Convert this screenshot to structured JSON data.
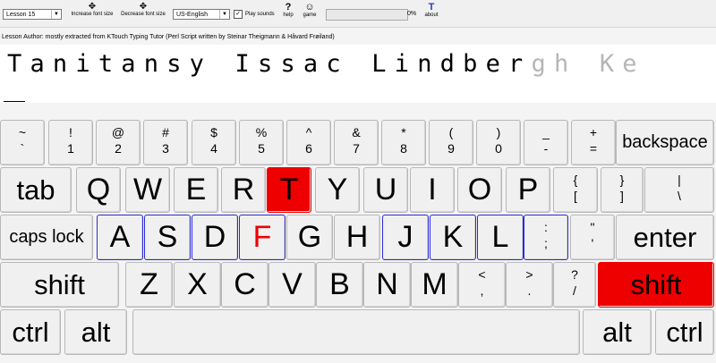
{
  "toolbar": {
    "lesson_select": "Lesson 15",
    "increase_font": "Increase font size",
    "decrease_font": "Decrease font size",
    "layout_select": "US-English",
    "play_sounds_label": "Play sounds",
    "play_sounds_checked": true,
    "help_label": "help",
    "game_label": "game",
    "progress_text": "0%",
    "progress_value": 0,
    "about_label": "about"
  },
  "author_text": "Lesson Author: mostly extracted from KTouch Typing Tutor (Perl Script written by Steinar Theigmann & Håvard Frøiland)",
  "practice": {
    "typed": "Tanitansy Issac Lindber",
    "pending": "gh Ke"
  },
  "keyboard": {
    "rows": [
      [
        {
          "id": "k-tilde",
          "top": "~",
          "bot": "`"
        },
        {
          "id": "k-1",
          "top": "!",
          "bot": "1"
        },
        {
          "id": "k-2",
          "top": "@",
          "bot": "2"
        },
        {
          "id": "k-3",
          "top": "#",
          "bot": "3"
        },
        {
          "id": "k-4",
          "top": "$",
          "bot": "4"
        },
        {
          "id": "k-5",
          "top": "%",
          "bot": "5"
        },
        {
          "id": "k-6",
          "top": "^",
          "bot": "6"
        },
        {
          "id": "k-7",
          "top": "&",
          "bot": "7"
        },
        {
          "id": "k-8",
          "top": "*",
          "bot": "8"
        },
        {
          "id": "k-9",
          "top": "(",
          "bot": "9"
        },
        {
          "id": "k-0",
          "top": ")",
          "bot": "0"
        },
        {
          "id": "k-minus",
          "top": "_",
          "bot": "-"
        },
        {
          "id": "k-equals",
          "top": "+",
          "bot": "="
        },
        {
          "id": "k-backspace",
          "label": "backspace"
        }
      ],
      [
        {
          "id": "k-tab",
          "label": "tab"
        },
        {
          "id": "k-q",
          "label": "Q"
        },
        {
          "id": "k-w",
          "label": "W"
        },
        {
          "id": "k-e",
          "label": "E"
        },
        {
          "id": "k-r",
          "label": "R"
        },
        {
          "id": "k-t",
          "label": "T"
        },
        {
          "id": "k-y",
          "label": "Y"
        },
        {
          "id": "k-u",
          "label": "U"
        },
        {
          "id": "k-i",
          "label": "I"
        },
        {
          "id": "k-o",
          "label": "O"
        },
        {
          "id": "k-p",
          "label": "P"
        },
        {
          "id": "k-lbracket",
          "top": "{",
          "bot": "["
        },
        {
          "id": "k-rbracket",
          "top": "}",
          "bot": "]"
        },
        {
          "id": "k-backslash",
          "top": "|",
          "bot": "\\"
        }
      ],
      [
        {
          "id": "k-capslock",
          "label": "caps lock"
        },
        {
          "id": "k-a",
          "label": "A"
        },
        {
          "id": "k-s",
          "label": "S"
        },
        {
          "id": "k-d",
          "label": "D"
        },
        {
          "id": "k-f",
          "label": "F"
        },
        {
          "id": "k-g",
          "label": "G"
        },
        {
          "id": "k-h",
          "label": "H"
        },
        {
          "id": "k-j",
          "label": "J"
        },
        {
          "id": "k-k",
          "label": "K"
        },
        {
          "id": "k-l",
          "label": "L"
        },
        {
          "id": "k-semicolon",
          "top": ":",
          "bot": ";"
        },
        {
          "id": "k-quote",
          "top": "\"",
          "bot": "'"
        },
        {
          "id": "k-enter",
          "label": "enter"
        }
      ],
      [
        {
          "id": "k-lshift",
          "label": "shift"
        },
        {
          "id": "k-z",
          "label": "Z"
        },
        {
          "id": "k-x",
          "label": "X"
        },
        {
          "id": "k-c",
          "label": "C"
        },
        {
          "id": "k-v",
          "label": "V"
        },
        {
          "id": "k-b",
          "label": "B"
        },
        {
          "id": "k-n",
          "label": "N"
        },
        {
          "id": "k-m",
          "label": "M"
        },
        {
          "id": "k-comma",
          "top": "<",
          "bot": ","
        },
        {
          "id": "k-period",
          "top": ">",
          "bot": "."
        },
        {
          "id": "k-slash",
          "top": "?",
          "bot": "/"
        },
        {
          "id": "k-rshift",
          "label": "shift"
        }
      ],
      [
        {
          "id": "k-lctrl",
          "label": "ctrl"
        },
        {
          "id": "k-lalt",
          "label": "alt"
        },
        {
          "id": "k-space",
          "label": ""
        },
        {
          "id": "k-ralt",
          "label": "alt"
        },
        {
          "id": "k-rctrl",
          "label": "ctrl"
        }
      ]
    ],
    "home_keys": [
      "k-a",
      "k-s",
      "k-d",
      "k-f",
      "k-j",
      "k-k",
      "k-l",
      "k-semicolon"
    ],
    "active_keys": [
      "k-t",
      "k-rshift"
    ],
    "highlight_home": "k-f",
    "colors": {
      "active": "#ee0000",
      "home_border": "#2b2bd6",
      "highlight_text": "#ee0000"
    }
  }
}
